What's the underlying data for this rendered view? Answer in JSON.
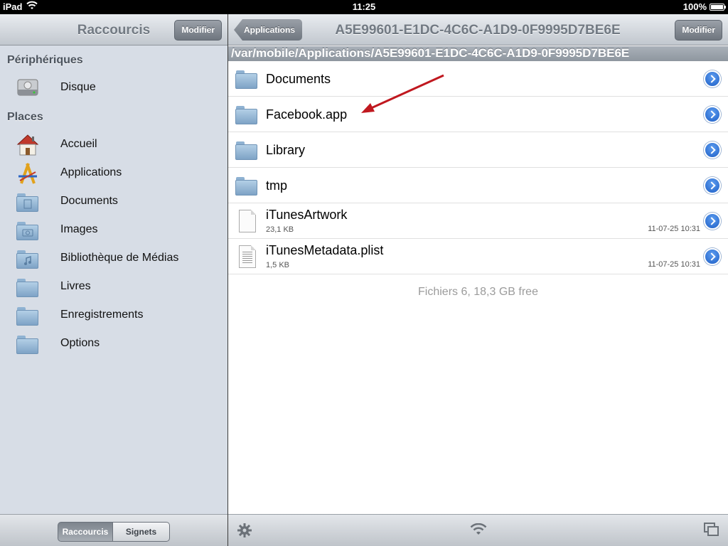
{
  "status_bar": {
    "carrier": "iPad",
    "time": "11:25",
    "battery": "100%"
  },
  "left": {
    "title": "Raccourcis",
    "edit_label": "Modifier",
    "sections": [
      {
        "header": "Périphériques",
        "items": [
          {
            "label": "Disque",
            "icon": "disk-icon"
          }
        ]
      },
      {
        "header": "Places",
        "items": [
          {
            "label": "Accueil",
            "icon": "home-icon"
          },
          {
            "label": "Applications",
            "icon": "applications-icon"
          },
          {
            "label": "Documents",
            "icon": "documents-folder-icon"
          },
          {
            "label": "Images",
            "icon": "images-folder-icon"
          },
          {
            "label": "Bibliothèque de Médias",
            "icon": "music-folder-icon"
          },
          {
            "label": "Livres",
            "icon": "folder-icon"
          },
          {
            "label": "Enregistrements",
            "icon": "folder-icon"
          },
          {
            "label": "Options",
            "icon": "folder-icon"
          }
        ]
      }
    ],
    "tabs": [
      "Raccourcis",
      "Signets"
    ],
    "selected_tab": "Raccourcis"
  },
  "right": {
    "back_label": "Applications",
    "title": "A5E99601-E1DC-4C6C-A1D9-0F9995D7BE6E",
    "edit_label": "Modifier",
    "path": "/var/mobile/Applications/A5E99601-E1DC-4C6C-A1D9-0F9995D7BE6E",
    "files": [
      {
        "name": "Documents",
        "type": "folder",
        "size": "",
        "date": ""
      },
      {
        "name": "Facebook.app",
        "type": "folder",
        "size": "",
        "date": ""
      },
      {
        "name": "Library",
        "type": "folder",
        "size": "",
        "date": ""
      },
      {
        "name": "tmp",
        "type": "folder",
        "size": "",
        "date": ""
      },
      {
        "name": "iTunesArtwork",
        "type": "file",
        "size": "23,1 KB",
        "date": "11-07-25 10:31"
      },
      {
        "name": "iTunesMetadata.plist",
        "type": "plist",
        "size": "1,5 KB",
        "date": "11-07-25 10:31"
      }
    ],
    "footer": "Fichiers 6, 18,3 GB free"
  },
  "colors": {
    "accent_blue": "#2a6fd6",
    "annotation_arrow": "#c0181f"
  }
}
